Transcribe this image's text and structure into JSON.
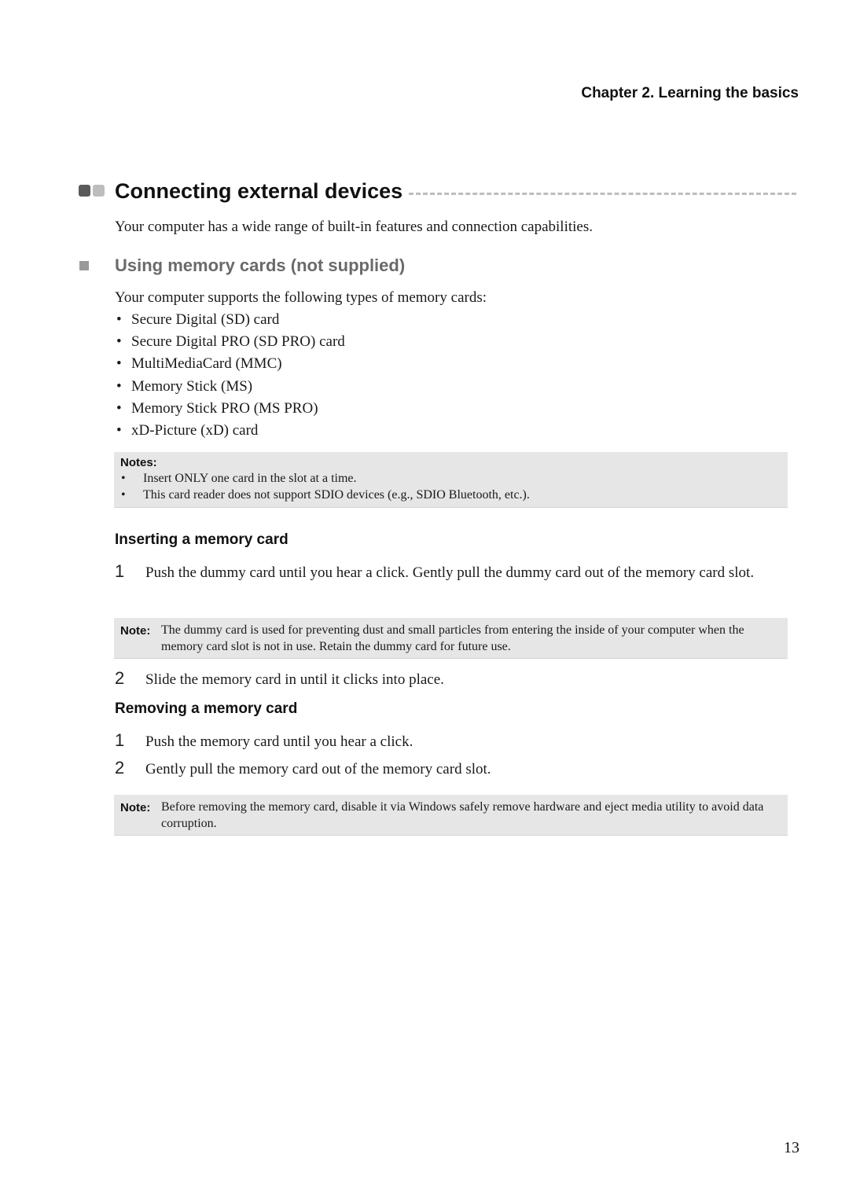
{
  "header": {
    "chapter": "Chapter 2. Learning the basics"
  },
  "section": {
    "title": "Connecting external devices",
    "intro": "Your computer has a wide range of built-in features and connection capabilities.",
    "icon_colors": [
      "#5a5a5a",
      "#bdbdbd"
    ]
  },
  "subsection": {
    "title": "Using memory cards (not supplied)",
    "intro": "Your computer supports the following types of memory cards:",
    "cards": [
      "Secure Digital (SD) card",
      "Secure Digital PRO (SD PRO) card",
      "MultiMediaCard (MMC)",
      "Memory Stick (MS)",
      "Memory Stick PRO (MS PRO)",
      "xD-Picture (xD) card"
    ],
    "notes": {
      "label": "Notes:",
      "items": [
        "Insert ONLY one card in the slot at a time.",
        "This card reader does not support SDIO devices (e.g., SDIO Bluetooth, etc.)."
      ]
    }
  },
  "inserting": {
    "heading": "Inserting a memory card",
    "steps": [
      {
        "num": "1",
        "text": "Push the dummy card until you hear a click. Gently pull the dummy card out of the memory card slot."
      },
      {
        "num": "2",
        "text": "Slide the memory card in until it clicks into place."
      }
    ],
    "note": {
      "label": "Note:",
      "text": "The dummy card is used for preventing dust and small particles from entering the inside of your computer when the memory card slot is not in use. Retain the dummy card for future use."
    }
  },
  "removing": {
    "heading": "Removing a memory card",
    "steps": [
      {
        "num": "1",
        "text": "Push the memory card until you hear a click."
      },
      {
        "num": "2",
        "text": "Gently pull the memory card out of the memory card slot."
      }
    ],
    "note": {
      "label": "Note:",
      "text": "Before removing the memory card, disable it via Windows safely remove hardware and eject media utility to avoid data corruption."
    }
  },
  "footer": {
    "page_number": "13"
  }
}
